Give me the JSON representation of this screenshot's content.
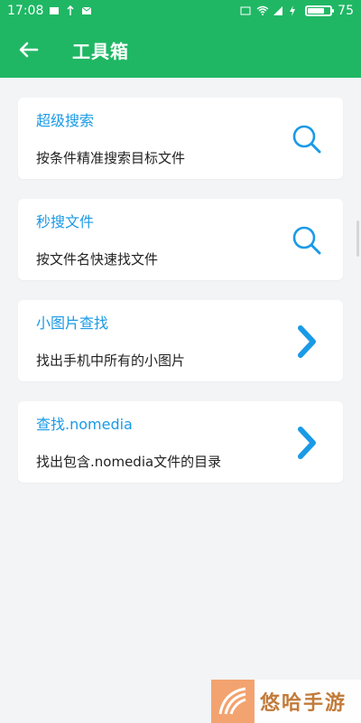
{
  "status_bar": {
    "time": "17:08",
    "battery_level": "75",
    "battery_fraction": 0.75
  },
  "app_bar": {
    "title": "工具箱"
  },
  "tools": [
    {
      "title": "超级搜索",
      "desc": "按条件精准搜索目标文件",
      "icon": "search-icon"
    },
    {
      "title": "秒搜文件",
      "desc": "按文件名快速找文件",
      "icon": "search-icon"
    },
    {
      "title": "小图片查找",
      "desc": "找出手机中所有的小图片",
      "icon": "chevron-right-icon"
    },
    {
      "title": "查找.nomedia",
      "desc": "找出包含.nomedia文件的目录",
      "icon": "chevron-right-icon"
    }
  ],
  "watermark": {
    "text": "悠哈手游"
  },
  "colors": {
    "primary": "#1fb764",
    "accent": "#1a9ae6"
  }
}
